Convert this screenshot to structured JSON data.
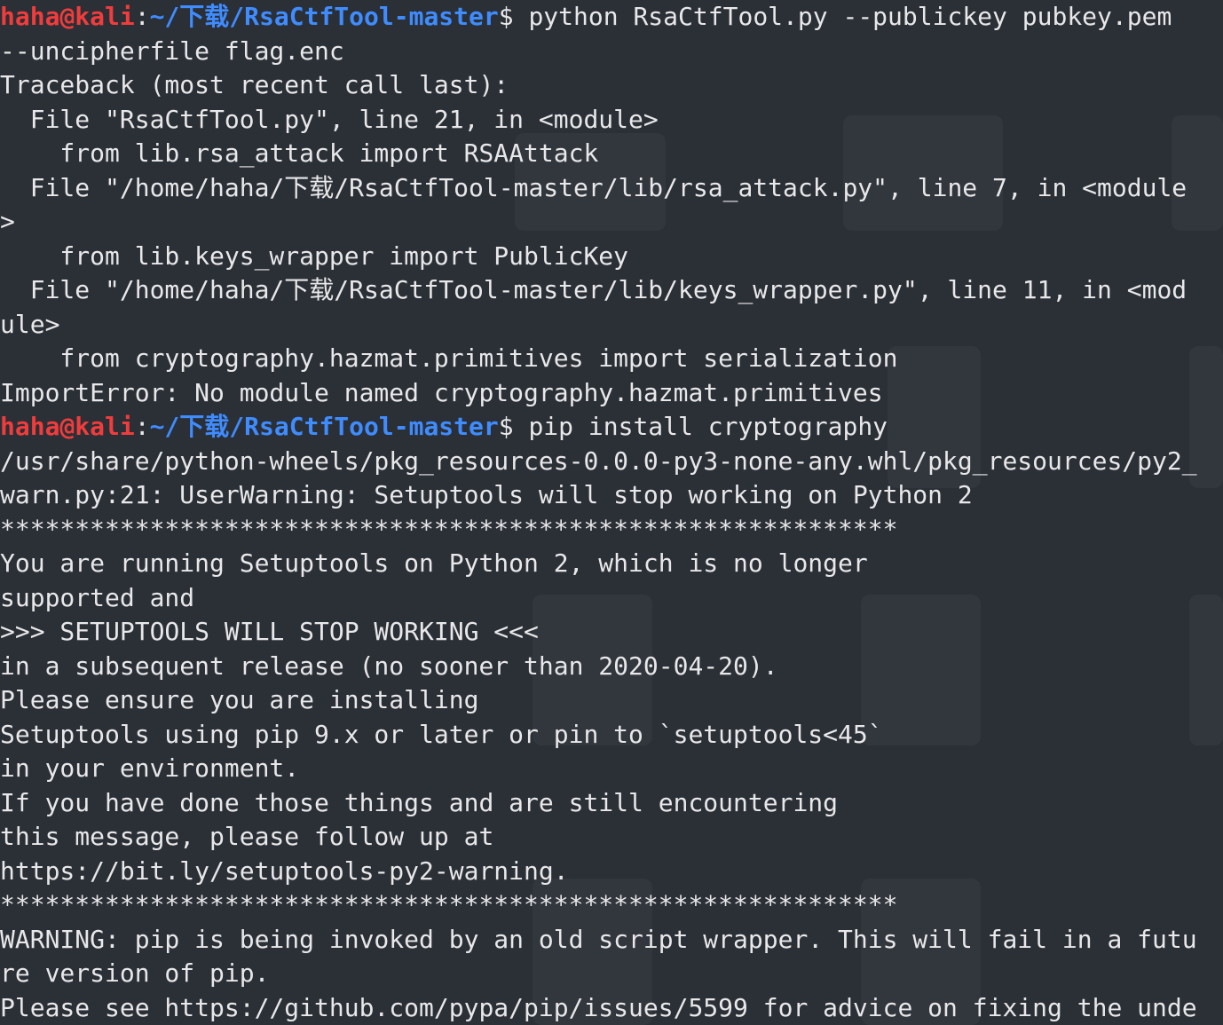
{
  "colors": {
    "background": "#2b2f36",
    "text": "#e8e8ea",
    "user": "#f03c3c",
    "path": "#3f8cff"
  },
  "prompt": {
    "user": "haha@kali",
    "colon": ":",
    "path": "~/下载/RsaCtfTool-master",
    "dollar": "$"
  },
  "lines": [
    {
      "type": "prompt",
      "command": " python RsaCtfTool.py --publickey pubkey.pem"
    },
    {
      "type": "text",
      "text": "--uncipherfile flag.enc"
    },
    {
      "type": "text",
      "text": "Traceback (most recent call last):"
    },
    {
      "type": "text",
      "text": "  File \"RsaCtfTool.py\", line 21, in <module>"
    },
    {
      "type": "text",
      "text": "    from lib.rsa_attack import RSAAttack"
    },
    {
      "type": "text",
      "text": "  File \"/home/haha/下载/RsaCtfTool-master/lib/rsa_attack.py\", line 7, in <module"
    },
    {
      "type": "text",
      "text": ">"
    },
    {
      "type": "text",
      "text": "    from lib.keys_wrapper import PublicKey"
    },
    {
      "type": "text",
      "text": "  File \"/home/haha/下载/RsaCtfTool-master/lib/keys_wrapper.py\", line 11, in <mod"
    },
    {
      "type": "text",
      "text": "ule>"
    },
    {
      "type": "text",
      "text": "    from cryptography.hazmat.primitives import serialization"
    },
    {
      "type": "text",
      "text": "ImportError: No module named cryptography.hazmat.primitives"
    },
    {
      "type": "prompt",
      "command": " pip install cryptography"
    },
    {
      "type": "text",
      "text": "/usr/share/python-wheels/pkg_resources-0.0.0-py3-none-any.whl/pkg_resources/py2_"
    },
    {
      "type": "text",
      "text": "warn.py:21: UserWarning: Setuptools will stop working on Python 2"
    },
    {
      "type": "text",
      "text": "************************************************************"
    },
    {
      "type": "text",
      "text": "You are running Setuptools on Python 2, which is no longer"
    },
    {
      "type": "text",
      "text": "supported and"
    },
    {
      "type": "text",
      "text": ">>> SETUPTOOLS WILL STOP WORKING <<<"
    },
    {
      "type": "text",
      "text": "in a subsequent release (no sooner than 2020-04-20)."
    },
    {
      "type": "text",
      "text": "Please ensure you are installing"
    },
    {
      "type": "text",
      "text": "Setuptools using pip 9.x or later or pin to `setuptools<45`"
    },
    {
      "type": "text",
      "text": "in your environment."
    },
    {
      "type": "text",
      "text": "If you have done those things and are still encountering"
    },
    {
      "type": "text",
      "text": "this message, please follow up at"
    },
    {
      "type": "text",
      "text": "https://bit.ly/setuptools-py2-warning."
    },
    {
      "type": "text",
      "text": "************************************************************"
    },
    {
      "type": "text",
      "text": "WARNING: pip is being invoked by an old script wrapper. This will fail in a futu"
    },
    {
      "type": "text",
      "text": "re version of pip."
    },
    {
      "type": "text",
      "text": "Please see https://github.com/pypa/pip/issues/5599 for advice on fixing the unde"
    }
  ]
}
